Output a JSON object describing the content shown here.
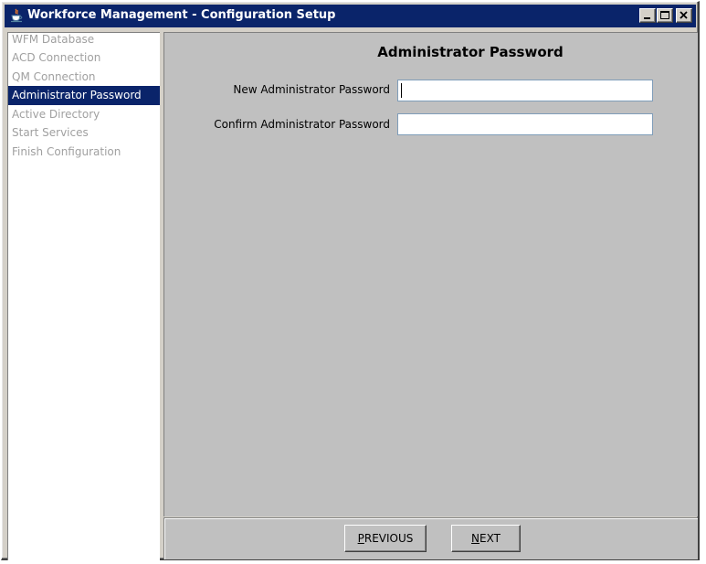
{
  "window": {
    "title": "Workforce Management - Configuration Setup",
    "icons": {
      "app": "java-cup-icon",
      "minimize": "minimize-icon",
      "maximize": "maximize-icon",
      "close": "close-icon"
    },
    "colors": {
      "titlebar": "#0a246a",
      "selection": "#0a246a",
      "panel": "#c0c0c0"
    }
  },
  "sidebar": {
    "items": [
      {
        "label": "WFM Database",
        "active": false
      },
      {
        "label": "ACD Connection",
        "active": false
      },
      {
        "label": "QM Connection",
        "active": false
      },
      {
        "label": "Administrator Password",
        "active": true
      },
      {
        "label": "Active Directory",
        "active": false
      },
      {
        "label": "Start Services",
        "active": false
      },
      {
        "label": "Finish Configuration",
        "active": false
      }
    ]
  },
  "main": {
    "title": "Administrator Password",
    "fields": {
      "new_password": {
        "label": "New Administrator Password",
        "value": ""
      },
      "confirm_password": {
        "label": "Confirm Administrator Password",
        "value": ""
      }
    }
  },
  "footer": {
    "previous": {
      "mnemonic": "P",
      "rest": "REVIOUS"
    },
    "next": {
      "mnemonic": "N",
      "rest": "EXT"
    }
  }
}
